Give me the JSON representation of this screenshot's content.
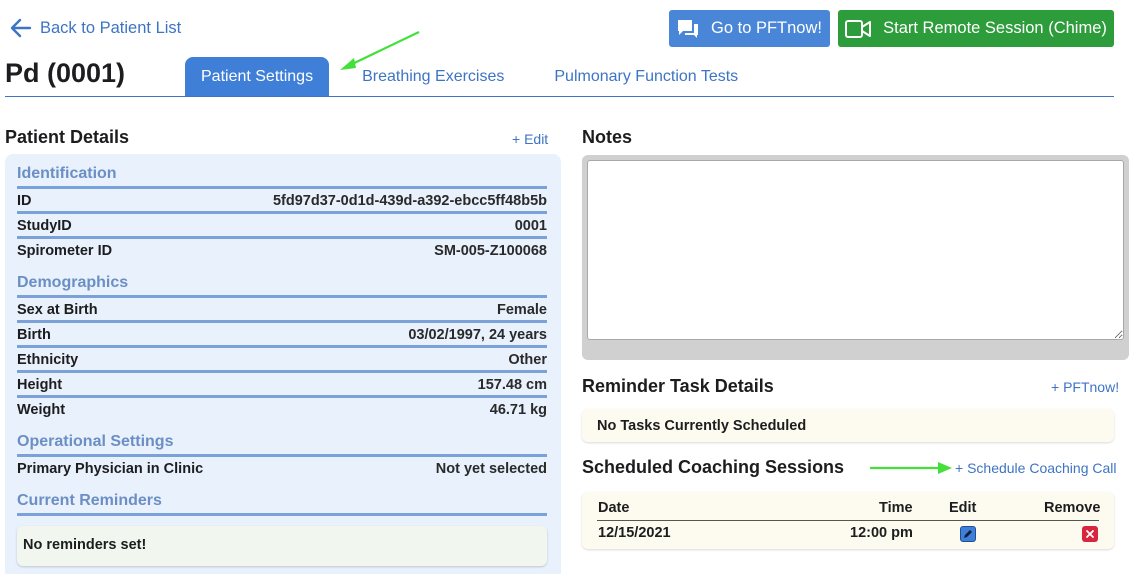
{
  "nav": {
    "back_label": "Back to Patient List"
  },
  "header": {
    "patient_title": "Pd (0001)",
    "pftnow_button": "Go to PFTnow!",
    "chime_button": "Start Remote Session (Chime)"
  },
  "tabs": [
    {
      "label": "Patient Settings",
      "active": true
    },
    {
      "label": "Breathing Exercises",
      "active": false
    },
    {
      "label": "Pulmonary Function Tests",
      "active": false
    }
  ],
  "patient_details": {
    "title": "Patient Details",
    "edit_label": "+ Edit",
    "identification": {
      "title": "Identification",
      "rows": [
        {
          "label": "ID",
          "value": "5fd97d37-0d1d-439d-a392-ebcc5ff48b5b"
        },
        {
          "label": "StudyID",
          "value": "0001"
        },
        {
          "label": "Spirometer ID",
          "value": "SM-005-Z100068"
        }
      ]
    },
    "demographics": {
      "title": "Demographics",
      "rows": [
        {
          "label": "Sex at Birth",
          "value": "Female"
        },
        {
          "label": "Birth",
          "value": "03/02/1997, 24 years"
        },
        {
          "label": "Ethnicity",
          "value": "Other"
        },
        {
          "label": "Height",
          "value": "157.48 cm"
        },
        {
          "label": "Weight",
          "value": "46.71 kg"
        }
      ]
    },
    "operational": {
      "title": "Operational Settings",
      "rows": [
        {
          "label": "Primary Physician in Clinic",
          "value": "Not yet selected"
        }
      ]
    },
    "reminders": {
      "title": "Current Reminders",
      "empty_text": "No reminders set!"
    }
  },
  "notes": {
    "title": "Notes",
    "value": ""
  },
  "reminder_tasks": {
    "title": "Reminder Task Details",
    "add_label": "+ PFTnow!",
    "empty_text": "No Tasks Currently Scheduled"
  },
  "coaching": {
    "title": "Scheduled Coaching Sessions",
    "add_label": "+ Schedule Coaching Call",
    "columns": [
      "Date",
      "Time",
      "Edit",
      "Remove"
    ],
    "rows": [
      {
        "date": "12/15/2021",
        "time": "12:00 pm"
      }
    ]
  },
  "colors": {
    "accent": "#3f7fd8",
    "success": "#2d9c3a",
    "danger": "#d7263d",
    "annotation_arrow": "#44e03a"
  },
  "icons": [
    "arrow-left-icon",
    "chat-icon",
    "video-camera-icon",
    "pencil-icon",
    "close-icon"
  ]
}
